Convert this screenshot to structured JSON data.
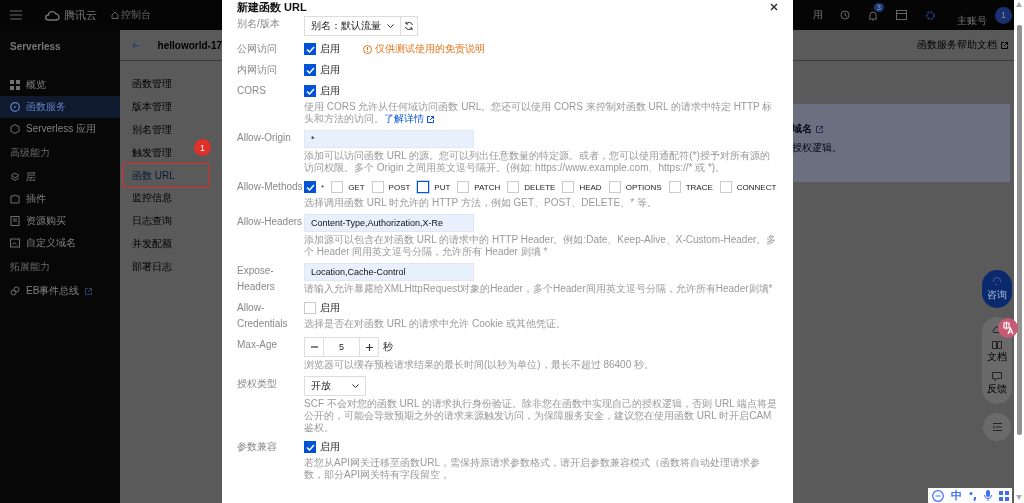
{
  "topbar": {
    "brand": "腾讯云",
    "console": "控制台",
    "cut_text": "用",
    "notification_count": "3",
    "account": "主账号",
    "avatar": "1"
  },
  "sidebar": {
    "title": "Serverless",
    "groups": [
      {
        "items": [
          {
            "label": "概览",
            "selected": false,
            "external": false
          },
          {
            "label": "函数服务",
            "selected": true,
            "external": false
          },
          {
            "label": "Serverless 应用",
            "selected": false,
            "external": false
          }
        ]
      },
      {
        "heading": "高级能力",
        "items": [
          {
            "label": "层",
            "selected": false,
            "external": false
          },
          {
            "label": "插件",
            "selected": false,
            "external": false
          },
          {
            "label": "资源购买",
            "selected": false,
            "external": false
          },
          {
            "label": "自定义域名",
            "selected": false,
            "external": false
          }
        ]
      },
      {
        "heading": "拓展能力",
        "items": [
          {
            "label": "EB事件总线",
            "selected": false,
            "external": true
          }
        ]
      }
    ]
  },
  "function_panel": {
    "title": "helloworld-17",
    "annotation_badge": "1",
    "items": [
      {
        "label": "函数管理",
        "selected": false,
        "annotated": false
      },
      {
        "label": "版本管理",
        "selected": false,
        "annotated": false
      },
      {
        "label": "别名管理",
        "selected": false,
        "annotated": false
      },
      {
        "label": "触发管理",
        "selected": false,
        "annotated": false
      },
      {
        "label": "函数 URL",
        "selected": true,
        "annotated": true
      },
      {
        "label": "监控信息",
        "selected": false,
        "annotated": false
      },
      {
        "label": "日志查询",
        "selected": false,
        "annotated": false
      },
      {
        "label": "并发配额",
        "selected": false,
        "annotated": false
      },
      {
        "label": "部署日志",
        "selected": false,
        "annotated": false
      }
    ]
  },
  "main": {
    "help_link": "函数服务帮助文档",
    "notice_title": "域名",
    "notice_text": "授权逻辑。"
  },
  "modal": {
    "title": "新建函数 URL",
    "rows": [
      {
        "label": "别名/版本",
        "kind": "select",
        "value": "别名：默认流量",
        "refresh": true
      },
      {
        "label": "公网访问",
        "kind": "checkbox",
        "checked": true,
        "option": "启用",
        "warning": "仅供测试使用的免责说明"
      },
      {
        "label": "内网访问",
        "kind": "checkbox",
        "checked": true,
        "option": "启用"
      },
      {
        "label": "CORS",
        "kind": "checkbox",
        "checked": true,
        "option": "启用",
        "help": "使用 CORS 允许从任何域访问函数 URL。您还可以使用 CORS 来控制对函数 URL 的请求中特定 HTTP 标头和方法的访问。",
        "help_link": "了解详情"
      },
      {
        "label": "Allow-Origin",
        "kind": "input",
        "value": "*",
        "help": "添加可以访问函数 URL 的源。您可以列出任意数量的特定源。或者，您可以使用通配符(*)授予对所有源的访问权限。多个 Origin 之间用英文逗号隔开。(例如: https://www.example.com、https://* 或 *)。"
      },
      {
        "label": "Allow-Methods",
        "kind": "methods",
        "options": [
          {
            "label": "*",
            "checked": true,
            "focused": false
          },
          {
            "label": "GET",
            "checked": false,
            "focused": false
          },
          {
            "label": "POST",
            "checked": false,
            "focused": false
          },
          {
            "label": "PUT",
            "checked": false,
            "focused": true
          },
          {
            "label": "PATCH",
            "checked": false,
            "focused": false
          },
          {
            "label": "DELETE",
            "checked": false,
            "focused": false
          },
          {
            "label": "HEAD",
            "checked": false,
            "focused": false
          },
          {
            "label": "OPTIONS",
            "checked": false,
            "focused": false
          },
          {
            "label": "TRACE",
            "checked": false,
            "focused": false
          },
          {
            "label": "CONNECT",
            "checked": false,
            "focused": false
          }
        ],
        "help": "选择调用函数 URL 时允许的 HTTP 方法，例如 GET、POST、DELETE、* 等。"
      },
      {
        "label": "Allow-Headers",
        "kind": "input",
        "value": "Content-Type,Authorization,X-Re",
        "help": "添加源可以包含在对函数 URL 的请求中的 HTTP Header。例如:Date、Keep-Alive、X-Custom-Header。多个 Header 间用英文逗号分隔，允许所有 Header 则填 *"
      },
      {
        "label": "Expose-Headers",
        "kind": "input",
        "value": "Location,Cache-Control",
        "help": "请输入允许暴露给XMLHttpRequest对象的Header，多个Header间用英文逗号分隔，允许所有Header则填*"
      },
      {
        "label": "Allow-Credentials",
        "kind": "checkbox",
        "checked": false,
        "option": "启用",
        "help": "选择是否在对函数 URL 的请求中允许 Cookie 或其他凭证。"
      },
      {
        "label": "Max-Age",
        "kind": "stepper",
        "value": "5",
        "unit": "秒",
        "help": "浏览器可以缓存预检请求结果的最长时间(以秒为单位)，最长不超过 86400 秒。"
      },
      {
        "label": "授权类型",
        "kind": "select",
        "value": "开放",
        "refresh": false,
        "help": "SCF 不会对您的函数 URL 的请求执行身份验证。除非您在函数中实现自己的授权逻辑，否则 URL 端点将是公开的，可能会导致预期之外的请求来源触发访问，为保障服务安全，建议您在使用函数 URL 时开启CAM鉴权。"
      },
      {
        "label": "参数兼容",
        "kind": "checkbox",
        "checked": true,
        "option": "启用",
        "help": "若您从API网关迁移至函数URL，需保持原请求参数格式，请开启参数兼容模式（函数将自动处理请求参数，部分API网关特有字段留空，"
      }
    ]
  },
  "float_bar": {
    "consult": "咨询",
    "items": [
      "文档",
      "反馈"
    ]
  },
  "ime_toolbar": {
    "label": "中"
  }
}
